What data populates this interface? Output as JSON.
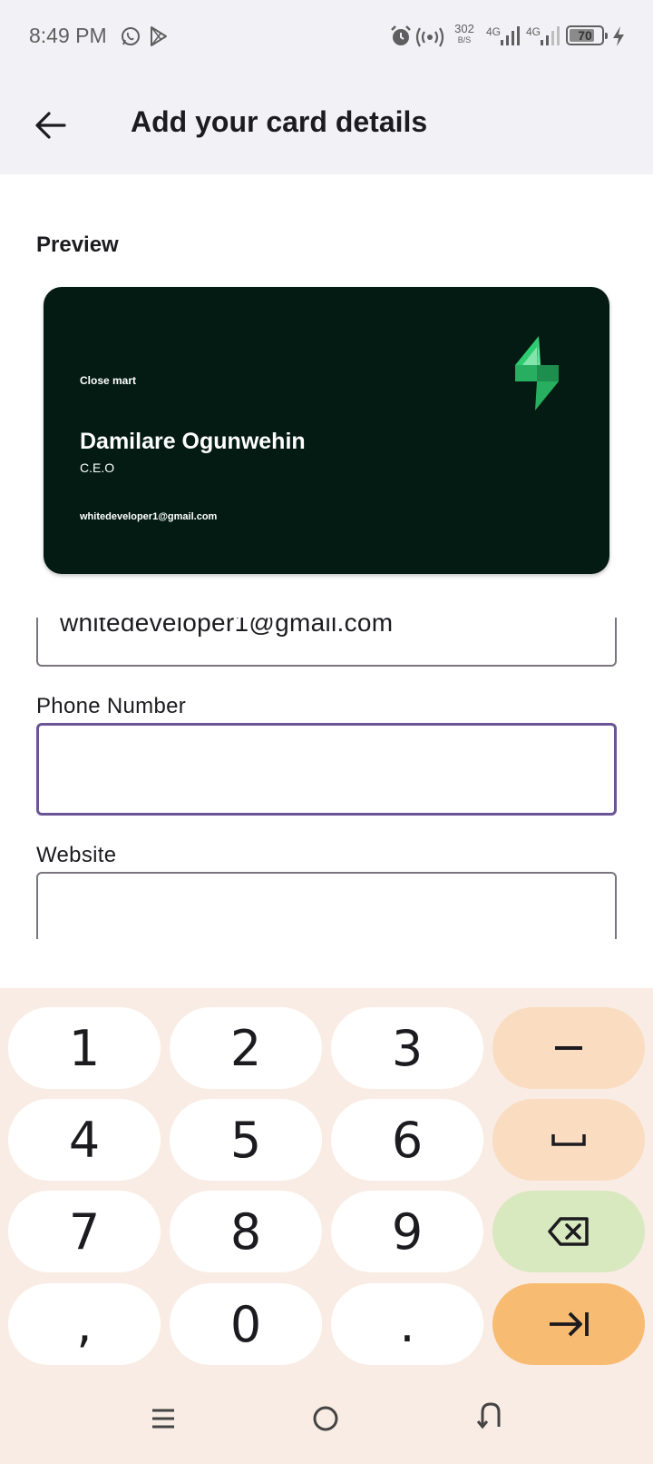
{
  "status_bar": {
    "time": "8:49 PM",
    "net_speed_value": "302",
    "net_speed_unit": "B/S",
    "net1": "4G",
    "net2": "4G",
    "battery": "70",
    "icons": [
      "whatsapp-icon",
      "play-store-icon",
      "alarm-icon",
      "hotspot-icon",
      "signal-icon",
      "charging-icon"
    ]
  },
  "app_bar": {
    "title": "Add your card details",
    "back_icon": "arrow-back-icon"
  },
  "preview": {
    "label": "Preview",
    "card": {
      "company": "Close mart",
      "name": "Damilare Ogunwehin",
      "role": "C.E.O",
      "email": "whitedeveloper1@gmail.com",
      "logo": "bolt-logo",
      "background": "#031b12",
      "logo_color": "#2ecc71"
    }
  },
  "form": {
    "email_value": "whitedeveloper1@gmail.com",
    "phone_label": "Phone Number",
    "phone_value": "",
    "website_label": "Website",
    "website_value": "",
    "focus_color": "#6b5596"
  },
  "keyboard": {
    "rows": [
      [
        "1",
        "2",
        "3",
        "–"
      ],
      [
        "4",
        "5",
        "6",
        "␣"
      ],
      [
        "7",
        "8",
        "9",
        "⌫"
      ],
      [
        ",",
        "0",
        ".",
        "⇥"
      ]
    ],
    "colors": {
      "background": "#f9ece4",
      "key": "#ffffff",
      "function_key": "#fadcc1",
      "delete_key": "#d8e8bf",
      "action_key": "#f8bb72"
    }
  },
  "nav_bar": {
    "icons": [
      "recents-icon",
      "home-icon",
      "back-nav-icon"
    ]
  }
}
